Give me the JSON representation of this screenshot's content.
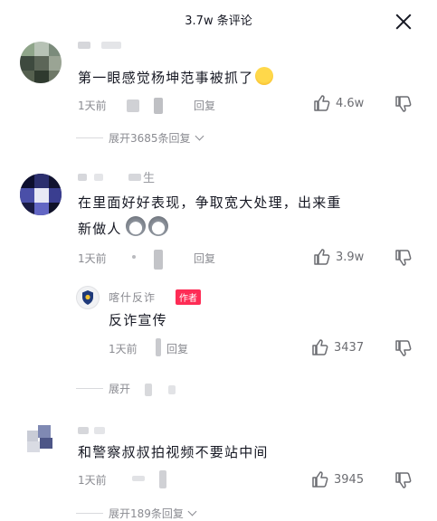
{
  "header": {
    "title": "3.7w 条评论"
  },
  "comments": [
    {
      "text": "第一眼感觉杨坤范事被抓了",
      "time": "1天前",
      "reply_label": "回复",
      "likes": "4.6w",
      "expand": "展开3685条回复"
    },
    {
      "name_suffix": "生",
      "text_line1": "在里面好好表现，争取宽大处理，出来重",
      "text_line2": "新做人",
      "time": "1天前",
      "reply_label": "回复",
      "likes": "3.9w",
      "reply": {
        "name": "喀什反诈",
        "badge": "作者",
        "text": "反诈宣传",
        "time": "1天前",
        "reply_label": "回复",
        "likes": "3437"
      },
      "expand": "展开"
    },
    {
      "text": "和警察叔叔拍视频不要站中间",
      "time": "1天前",
      "likes": "3945",
      "expand": "展开189条回复"
    }
  ],
  "icons": [
    "close-icon",
    "like-icon",
    "dislike-icon",
    "chevron-down-icon",
    "laughing-emoji",
    "husky-emoji"
  ],
  "colors": {
    "accent": "#fe2c55",
    "text": "#161823",
    "muted": "#8a8b91"
  }
}
